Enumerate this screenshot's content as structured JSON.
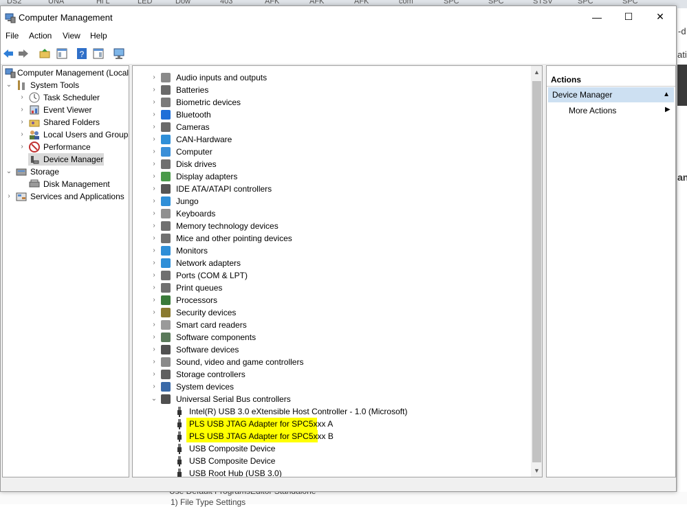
{
  "browser_tabs": [
    "DS2",
    "UNA",
    "Hi L",
    "LED",
    "Dow",
    "403",
    "AFK",
    "AFK",
    "AFK",
    "com",
    "SPC",
    "SPC",
    "STSV",
    "SPC",
    "SPC"
  ],
  "background": {
    "right_texts": [
      "-d",
      "ati",
      "an"
    ],
    "bottom_texts": [
      "Use Default ProgramsEditor Standalone",
      "1)   File Type Settings"
    ]
  },
  "window": {
    "title": "Computer Management",
    "controls": {
      "minimize": "—",
      "maximize": "☐",
      "close": "✕"
    }
  },
  "menu": [
    "File",
    "Action",
    "View",
    "Help"
  ],
  "toolbar": [
    "back-arrow-icon",
    "forward-arrow-icon",
    "up-folder-icon",
    "show-hide-tree-icon",
    "help-icon",
    "properties-icon",
    "monitor-icon"
  ],
  "left_tree": {
    "root": "Computer Management (Local)",
    "system_tools": "System Tools",
    "items": [
      "Task Scheduler",
      "Event Viewer",
      "Shared Folders",
      "Local Users and Groups",
      "Performance",
      "Device Manager"
    ],
    "storage": "Storage",
    "storage_items": [
      "Disk Management"
    ],
    "services": "Services and Applications",
    "selected": "Device Manager"
  },
  "device_categories": [
    "Audio inputs and outputs",
    "Batteries",
    "Biometric devices",
    "Bluetooth",
    "Cameras",
    "CAN-Hardware",
    "Computer",
    "Disk drives",
    "Display adapters",
    "IDE ATA/ATAPI controllers",
    "Jungo",
    "Keyboards",
    "Memory technology devices",
    "Mice and other pointing devices",
    "Monitors",
    "Network adapters",
    "Ports (COM & LPT)",
    "Print queues",
    "Processors",
    "Security devices",
    "Smart card readers",
    "Software components",
    "Software devices",
    "Sound, video and game controllers",
    "Storage controllers",
    "System devices",
    "Universal Serial Bus controllers"
  ],
  "usb_children": [
    "Intel(R) USB 3.0 eXtensible Host Controller - 1.0 (Microsoft)",
    "PLS USB JTAG Adapter for SPC5xxx A",
    "PLS USB JTAG Adapter for SPC5xxx B",
    "USB Composite Device",
    "USB Composite Device",
    "USB Root Hub (USB 3.0)"
  ],
  "highlight_color": "#ffff00",
  "actions": {
    "header": "Actions",
    "section": "Device Manager",
    "more": "More Actions"
  }
}
